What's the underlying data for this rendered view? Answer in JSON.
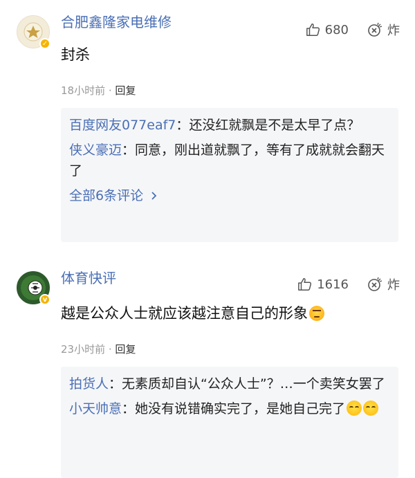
{
  "comments": [
    {
      "username": "合肥鑫隆家电维修",
      "likes": "680",
      "dislike_label": "炸",
      "text": "封杀",
      "time": "18小时前",
      "reply_label": "回复",
      "replies": [
        {
          "user": "百度网友077eaf7",
          "text": "还没红就飘是不是太早了点？"
        },
        {
          "user": "侠义豪迈",
          "text": "同意，刚出道就飘了，等有了成就就会翻天了"
        }
      ],
      "see_all": "全部6条评论"
    },
    {
      "username": "体育快评",
      "likes": "1616",
      "dislike_label": "炸",
      "text": "越是公众人士就应该越注意自己的形象",
      "time": "23小时前",
      "reply_label": "回复",
      "replies": [
        {
          "user": "拍货人",
          "text": "无素质却自认“公众人士”？…一个卖笑女罢了"
        },
        {
          "user": "小天帅意",
          "text": "她没有说错确实完了，是她自己完了"
        }
      ]
    }
  ],
  "colors": {
    "username": "#4a6fb5",
    "reply_box": "#f5f6f8",
    "badge": "#f6b400"
  },
  "icons": {
    "like": "thumbs-up-icon",
    "dislike": "bomb-icon",
    "emoji_cry": "laugh-cry-emoji-icon",
    "emoji_angry": "angry-face-emoji-icon",
    "verified": "verified-v-badge-icon",
    "chevron": "chevron-right-icon"
  }
}
